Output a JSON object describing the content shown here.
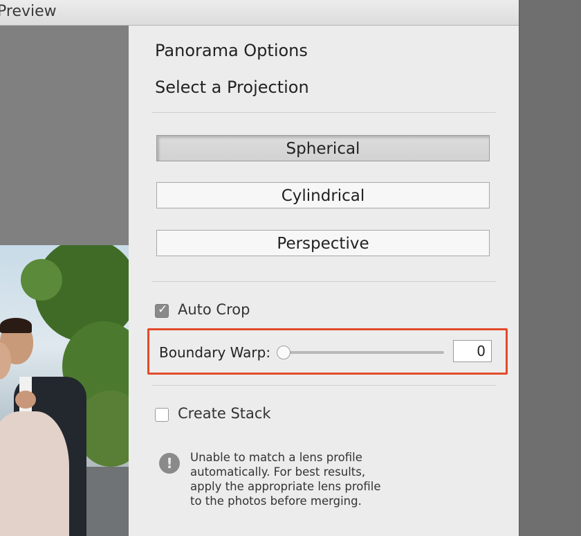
{
  "window": {
    "title": "Preview"
  },
  "panel": {
    "title": "Panorama Options",
    "projection_heading": "Select a Projection",
    "projections": [
      {
        "label": "Spherical",
        "selected": true
      },
      {
        "label": "Cylindrical",
        "selected": false
      },
      {
        "label": "Perspective",
        "selected": false
      }
    ],
    "auto_crop": {
      "label": "Auto Crop",
      "checked": true
    },
    "boundary_warp": {
      "label": "Boundary Warp:",
      "value": "0",
      "slider_fraction": 0.0
    },
    "create_stack": {
      "label": "Create Stack",
      "checked": false
    },
    "warning": {
      "icon": "exclamation-icon",
      "lines": [
        "Unable to match a lens profile",
        "automatically. For best results,",
        "apply the appropriate lens profile",
        "to the photos before merging."
      ]
    }
  },
  "colors": {
    "highlight": "#e34a2a",
    "panel_bg": "#ececec",
    "preview_bg": "#808080"
  }
}
